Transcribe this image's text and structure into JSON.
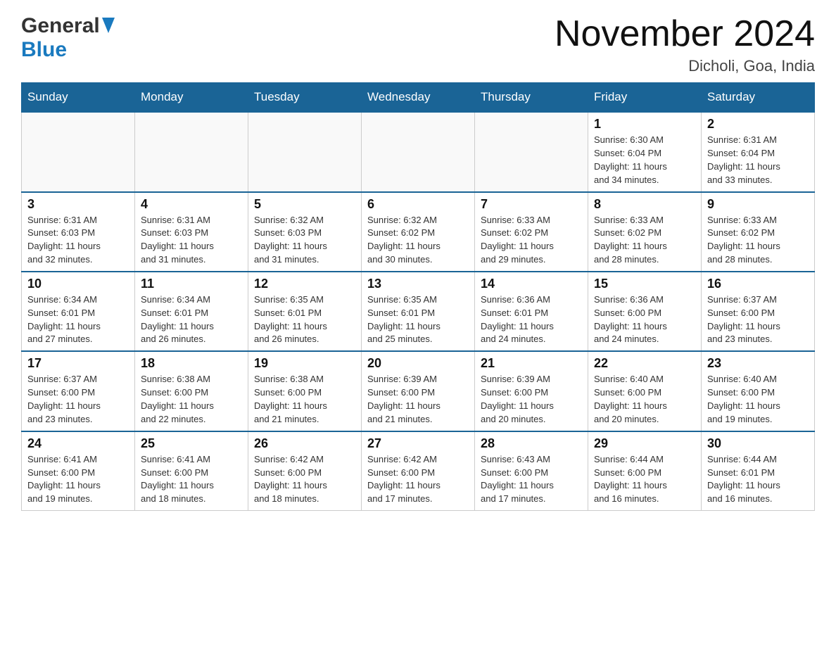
{
  "header": {
    "logo_general": "General",
    "logo_blue": "Blue",
    "month_title": "November 2024",
    "location": "Dicholi, Goa, India"
  },
  "days_of_week": [
    "Sunday",
    "Monday",
    "Tuesday",
    "Wednesday",
    "Thursday",
    "Friday",
    "Saturday"
  ],
  "weeks": [
    [
      {
        "day": "",
        "info": ""
      },
      {
        "day": "",
        "info": ""
      },
      {
        "day": "",
        "info": ""
      },
      {
        "day": "",
        "info": ""
      },
      {
        "day": "",
        "info": ""
      },
      {
        "day": "1",
        "info": "Sunrise: 6:30 AM\nSunset: 6:04 PM\nDaylight: 11 hours\nand 34 minutes."
      },
      {
        "day": "2",
        "info": "Sunrise: 6:31 AM\nSunset: 6:04 PM\nDaylight: 11 hours\nand 33 minutes."
      }
    ],
    [
      {
        "day": "3",
        "info": "Sunrise: 6:31 AM\nSunset: 6:03 PM\nDaylight: 11 hours\nand 32 minutes."
      },
      {
        "day": "4",
        "info": "Sunrise: 6:31 AM\nSunset: 6:03 PM\nDaylight: 11 hours\nand 31 minutes."
      },
      {
        "day": "5",
        "info": "Sunrise: 6:32 AM\nSunset: 6:03 PM\nDaylight: 11 hours\nand 31 minutes."
      },
      {
        "day": "6",
        "info": "Sunrise: 6:32 AM\nSunset: 6:02 PM\nDaylight: 11 hours\nand 30 minutes."
      },
      {
        "day": "7",
        "info": "Sunrise: 6:33 AM\nSunset: 6:02 PM\nDaylight: 11 hours\nand 29 minutes."
      },
      {
        "day": "8",
        "info": "Sunrise: 6:33 AM\nSunset: 6:02 PM\nDaylight: 11 hours\nand 28 minutes."
      },
      {
        "day": "9",
        "info": "Sunrise: 6:33 AM\nSunset: 6:02 PM\nDaylight: 11 hours\nand 28 minutes."
      }
    ],
    [
      {
        "day": "10",
        "info": "Sunrise: 6:34 AM\nSunset: 6:01 PM\nDaylight: 11 hours\nand 27 minutes."
      },
      {
        "day": "11",
        "info": "Sunrise: 6:34 AM\nSunset: 6:01 PM\nDaylight: 11 hours\nand 26 minutes."
      },
      {
        "day": "12",
        "info": "Sunrise: 6:35 AM\nSunset: 6:01 PM\nDaylight: 11 hours\nand 26 minutes."
      },
      {
        "day": "13",
        "info": "Sunrise: 6:35 AM\nSunset: 6:01 PM\nDaylight: 11 hours\nand 25 minutes."
      },
      {
        "day": "14",
        "info": "Sunrise: 6:36 AM\nSunset: 6:01 PM\nDaylight: 11 hours\nand 24 minutes."
      },
      {
        "day": "15",
        "info": "Sunrise: 6:36 AM\nSunset: 6:00 PM\nDaylight: 11 hours\nand 24 minutes."
      },
      {
        "day": "16",
        "info": "Sunrise: 6:37 AM\nSunset: 6:00 PM\nDaylight: 11 hours\nand 23 minutes."
      }
    ],
    [
      {
        "day": "17",
        "info": "Sunrise: 6:37 AM\nSunset: 6:00 PM\nDaylight: 11 hours\nand 23 minutes."
      },
      {
        "day": "18",
        "info": "Sunrise: 6:38 AM\nSunset: 6:00 PM\nDaylight: 11 hours\nand 22 minutes."
      },
      {
        "day": "19",
        "info": "Sunrise: 6:38 AM\nSunset: 6:00 PM\nDaylight: 11 hours\nand 21 minutes."
      },
      {
        "day": "20",
        "info": "Sunrise: 6:39 AM\nSunset: 6:00 PM\nDaylight: 11 hours\nand 21 minutes."
      },
      {
        "day": "21",
        "info": "Sunrise: 6:39 AM\nSunset: 6:00 PM\nDaylight: 11 hours\nand 20 minutes."
      },
      {
        "day": "22",
        "info": "Sunrise: 6:40 AM\nSunset: 6:00 PM\nDaylight: 11 hours\nand 20 minutes."
      },
      {
        "day": "23",
        "info": "Sunrise: 6:40 AM\nSunset: 6:00 PM\nDaylight: 11 hours\nand 19 minutes."
      }
    ],
    [
      {
        "day": "24",
        "info": "Sunrise: 6:41 AM\nSunset: 6:00 PM\nDaylight: 11 hours\nand 19 minutes."
      },
      {
        "day": "25",
        "info": "Sunrise: 6:41 AM\nSunset: 6:00 PM\nDaylight: 11 hours\nand 18 minutes."
      },
      {
        "day": "26",
        "info": "Sunrise: 6:42 AM\nSunset: 6:00 PM\nDaylight: 11 hours\nand 18 minutes."
      },
      {
        "day": "27",
        "info": "Sunrise: 6:42 AM\nSunset: 6:00 PM\nDaylight: 11 hours\nand 17 minutes."
      },
      {
        "day": "28",
        "info": "Sunrise: 6:43 AM\nSunset: 6:00 PM\nDaylight: 11 hours\nand 17 minutes."
      },
      {
        "day": "29",
        "info": "Sunrise: 6:44 AM\nSunset: 6:00 PM\nDaylight: 11 hours\nand 16 minutes."
      },
      {
        "day": "30",
        "info": "Sunrise: 6:44 AM\nSunset: 6:01 PM\nDaylight: 11 hours\nand 16 minutes."
      }
    ]
  ]
}
